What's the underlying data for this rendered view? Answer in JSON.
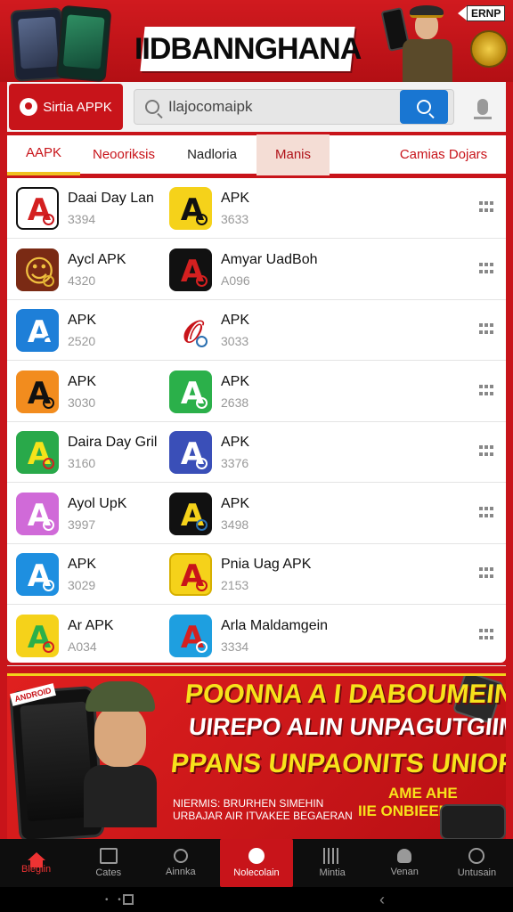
{
  "header": {
    "banner_title": "IIDBANNGHANA",
    "tag_label": "ERNP"
  },
  "brand": {
    "label": "Sirtia APPK"
  },
  "search": {
    "value": "Ilajocomaipk"
  },
  "tabs": [
    {
      "label": "AAPK"
    },
    {
      "label": "Neooriksis"
    },
    {
      "label": "Nadloria"
    },
    {
      "label": "Manis"
    },
    {
      "label": "Camias Dojars"
    }
  ],
  "rows": [
    {
      "left": {
        "name": "Daai Day Lan",
        "count": "3394",
        "icon": {
          "bg": "#ffffff",
          "border": "#111111",
          "fg": "#d42020",
          "glyph": "A",
          "badge": "#c8141a"
        }
      },
      "right": {
        "name": "APK",
        "count": "3633",
        "icon": {
          "bg": "#f5d21a",
          "border": "#f5d21a",
          "fg": "#111111",
          "glyph": "A",
          "badge": "#111111"
        }
      }
    },
    {
      "left": {
        "name": "Aycl APK",
        "count": "4320",
        "icon": {
          "bg": "#7a2a14",
          "border": "#7a2a14",
          "fg": "#f0c040",
          "glyph": "☺",
          "badge": "#e0b030"
        }
      },
      "right": {
        "name": "Amyar UadBoh",
        "count": "A096",
        "icon": {
          "bg": "#111111",
          "border": "#111111",
          "fg": "#d42020",
          "glyph": "A",
          "badge": "#d42020"
        }
      }
    },
    {
      "left": {
        "name": "APK",
        "count": "2520",
        "icon": {
          "bg": "#1e7fd8",
          "border": "#1e7fd8",
          "fg": "#ffffff",
          "glyph": "A",
          "badge": "#1e7fd8"
        }
      },
      "right": {
        "name": "APK",
        "count": "3033",
        "icon": {
          "bg": "#ffffff",
          "border": "#ffffff",
          "fg": "#c8141a",
          "glyph": "𝒪",
          "badge": "#2a6fb0"
        }
      }
    },
    {
      "left": {
        "name": "APK",
        "count": "3030",
        "icon": {
          "bg": "#f28c1e",
          "border": "#f28c1e",
          "fg": "#111111",
          "glyph": "A",
          "badge": "#111111"
        }
      },
      "right": {
        "name": "APK",
        "count": "2638",
        "icon": {
          "bg": "#2bb04a",
          "border": "#2bb04a",
          "fg": "#ffffff",
          "glyph": "A",
          "badge": "#ffffff"
        }
      }
    },
    {
      "left": {
        "name": "Daira Day Gril",
        "count": "3160",
        "icon": {
          "bg": "#29a94a",
          "border": "#29a94a",
          "fg": "#f5e31a",
          "glyph": "A",
          "badge": "#d42020"
        }
      },
      "right": {
        "name": "APK",
        "count": "3376",
        "icon": {
          "bg": "#3a4fb8",
          "border": "#3a4fb8",
          "fg": "#ffffff",
          "glyph": "A",
          "badge": "#ffffff"
        }
      }
    },
    {
      "left": {
        "name": "Ayol UpK",
        "count": "3997",
        "icon": {
          "bg": "#d06ad8",
          "border": "#d06ad8",
          "fg": "#ffffff",
          "glyph": "A",
          "badge": "#ffffff"
        }
      },
      "right": {
        "name": "APK",
        "count": "3498",
        "icon": {
          "bg": "#111111",
          "border": "#111111",
          "fg": "#f5d21a",
          "glyph": "A",
          "badge": "#2a6fb0"
        }
      }
    },
    {
      "left": {
        "name": "APK",
        "count": "3029",
        "icon": {
          "bg": "#1e8fe0",
          "border": "#1e8fe0",
          "fg": "#ffffff",
          "glyph": "A",
          "badge": "#ffffff"
        }
      },
      "right": {
        "name": "Pnia Uag APK",
        "count": "2153",
        "icon": {
          "bg": "#f5d21a",
          "border": "#d6b000",
          "fg": "#c8141a",
          "glyph": "A",
          "badge": "#c8141a"
        }
      }
    },
    {
      "left": {
        "name": "Ar APK",
        "count": "A034",
        "icon": {
          "bg": "#f5d21a",
          "border": "#f5d21a",
          "fg": "#2bb04a",
          "glyph": "A",
          "badge": "#d42020"
        }
      },
      "right": {
        "name": "Arla Maldamgein",
        "count": "3334",
        "icon": {
          "bg": "#1e9fe0",
          "border": "#1e9fe0",
          "fg": "#d42020",
          "glyph": "A",
          "badge": "#ffffff"
        }
      }
    }
  ],
  "promo": {
    "badge": "ANDROID",
    "line1": "POONNA A I DABOUMEIN",
    "line2": "UIREPO ALIN UNPAGUTGIIM",
    "line3": "PPANS UNPAONITS UNIORNSS !",
    "line4": "NIERMIS: BRURHEN SIMEHIN",
    "line5": "URBAJAR AIR ITVAKEE BEGAERAN",
    "line6": "AME AHE",
    "line7": "IIE ONBIEEN DIRBL"
  },
  "bottom_nav": [
    {
      "label": "Blegiin"
    },
    {
      "label": "Cates"
    },
    {
      "label": "Ainnka"
    },
    {
      "label": "Nolecolain"
    },
    {
      "label": "Mintia"
    },
    {
      "label": "Venan"
    },
    {
      "label": "Untusain"
    }
  ],
  "colors": {
    "brand_red": "#c8141a",
    "accent_yellow": "#f7e21b",
    "search_blue": "#1976d2"
  }
}
